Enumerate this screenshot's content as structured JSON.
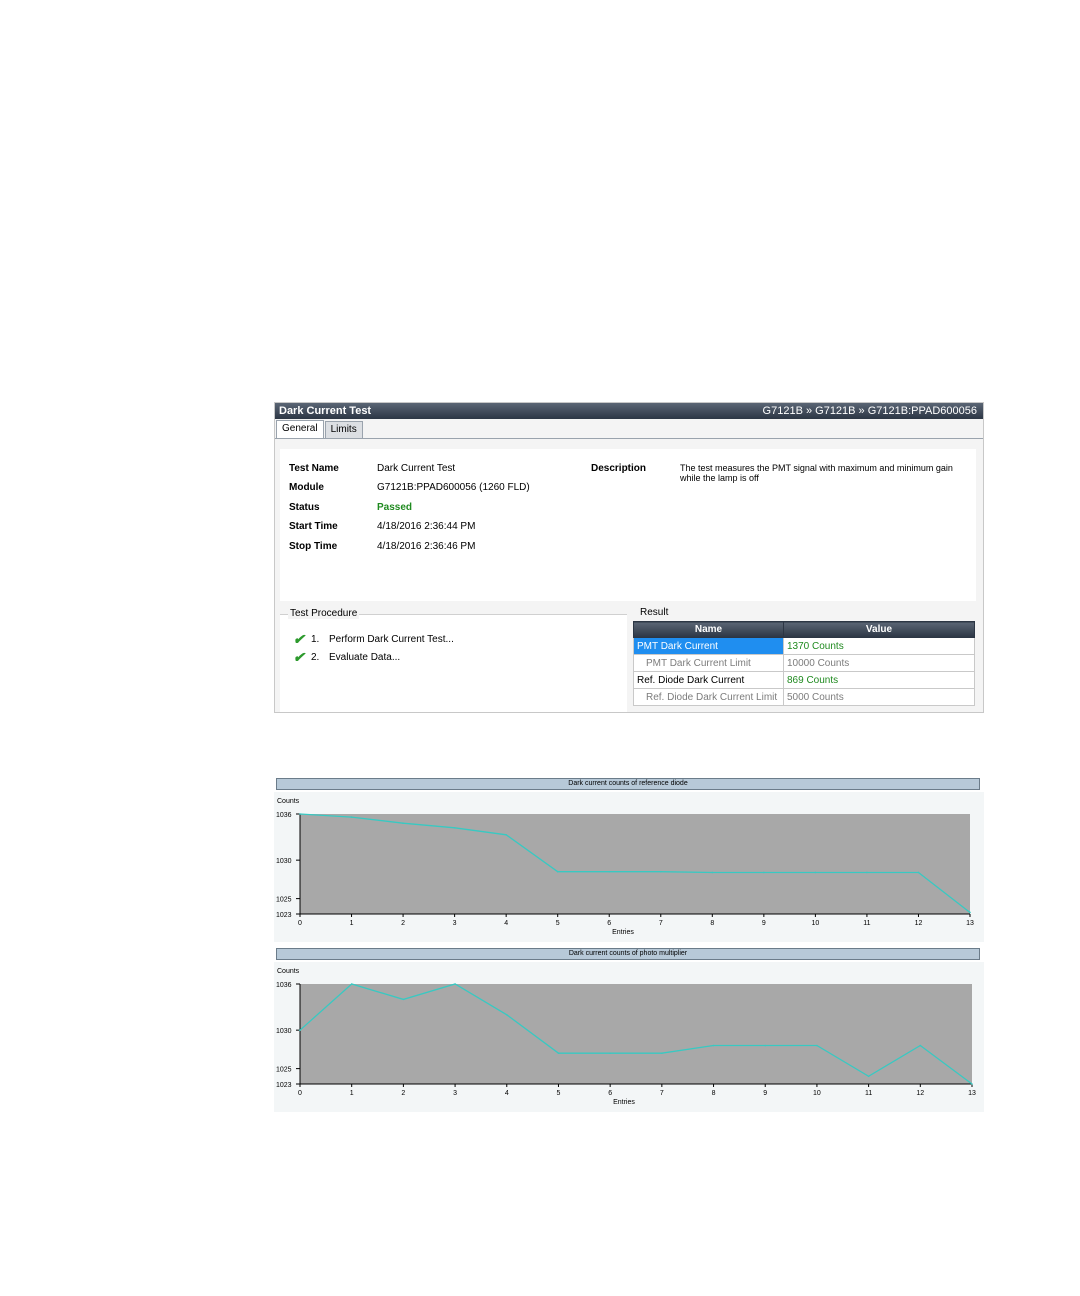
{
  "window": {
    "title": "Dark Current Test",
    "breadcrumb": "G7121B » G7121B » G7121B:PPAD600056",
    "tabs": [
      "General",
      "Limits"
    ]
  },
  "general": {
    "test_name_label": "Test Name",
    "test_name": "Dark Current Test",
    "module_label": "Module",
    "module": "G7121B:PPAD600056 (1260 FLD)",
    "status_label": "Status",
    "status": "Passed",
    "start_label": "Start Time",
    "start": "4/18/2016 2:36:44 PM",
    "stop_label": "Stop Time",
    "stop": "4/18/2016 2:36:46 PM",
    "description_label": "Description",
    "description": "The test measures the PMT signal with maximum and minimum gain while the lamp is off"
  },
  "procedure": {
    "title": "Test Procedure",
    "steps": [
      {
        "num": "1.",
        "text": "Perform Dark Current Test..."
      },
      {
        "num": "2.",
        "text": "Evaluate Data..."
      }
    ]
  },
  "result": {
    "title": "Result",
    "headers": [
      "Name",
      "Value"
    ],
    "rows": [
      {
        "name": "PMT Dark Current",
        "value": "1370 Counts"
      },
      {
        "name": "PMT Dark Current Limit",
        "value": "10000 Counts"
      },
      {
        "name": "Ref. Diode Dark Current",
        "value": "869 Counts"
      },
      {
        "name": "Ref. Diode Dark Current Limit",
        "value": "5000 Counts"
      }
    ]
  },
  "colors": {
    "line": "#38c9c2",
    "plot_bg": "#a8a8a8",
    "passed": "#1f8a1f",
    "selected": "#1f8ef0"
  },
  "chart_data": [
    {
      "type": "line",
      "title": "Dark current counts of reference diode",
      "xlabel": "Entries",
      "ylabel": "Counts",
      "x": [
        0,
        1,
        2,
        3,
        4,
        5,
        6,
        7,
        8,
        9,
        10,
        11,
        12,
        13
      ],
      "values": [
        1036,
        1035.6,
        1034.8,
        1034.2,
        1033.3,
        1028.5,
        1028.5,
        1028.5,
        1028.4,
        1028.4,
        1028.4,
        1028.4,
        1028.4,
        1023.2
      ],
      "yticks": [
        1023,
        1025,
        1030,
        1036
      ],
      "xlim": [
        0,
        13
      ],
      "ylim": [
        1023,
        1036
      ],
      "grid": false
    },
    {
      "type": "line",
      "title": "Dark current counts of photo multiplier",
      "xlabel": "Entries",
      "ylabel": "Counts",
      "x": [
        0,
        1,
        2,
        3,
        4,
        5,
        6,
        7,
        8,
        9,
        10,
        11,
        12,
        13
      ],
      "values": [
        1030,
        1036,
        1034,
        1036,
        1032,
        1027,
        1027,
        1027,
        1028,
        1028,
        1028,
        1024,
        1028,
        1023
      ],
      "yticks": [
        1023,
        1025,
        1030,
        1036
      ],
      "xlim": [
        0,
        13
      ],
      "ylim": [
        1023,
        1036
      ],
      "grid": false
    }
  ]
}
